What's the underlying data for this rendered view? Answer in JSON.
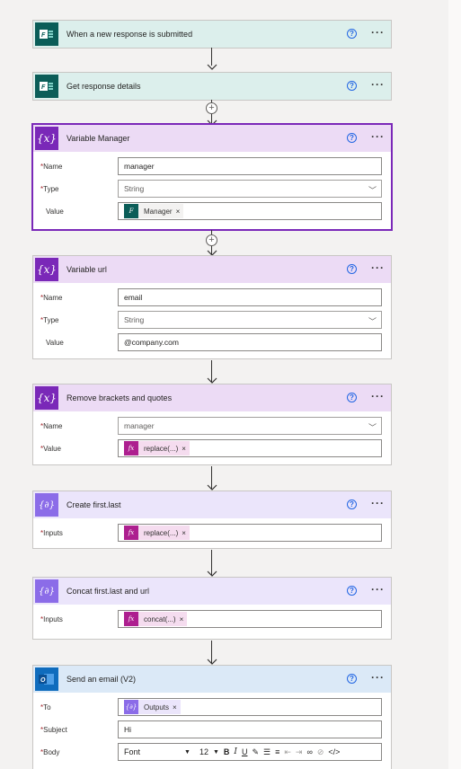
{
  "steps": [
    {
      "title": "When a new response is submitted",
      "icon": "forms-icon"
    },
    {
      "title": "Get response details",
      "icon": "forms-icon"
    },
    {
      "title": "Variable Manager",
      "icon": "variable-icon",
      "fields": {
        "name_label": "Name",
        "name_value": "manager",
        "type_label": "Type",
        "type_value": "String",
        "value_label": "Value",
        "value_token": "Manager"
      }
    },
    {
      "title": "Variable url",
      "icon": "variable-icon",
      "fields": {
        "name_label": "Name",
        "name_value": "email",
        "type_label": "Type",
        "type_value": "String",
        "value_label": "Value",
        "value_value": "@company.com"
      }
    },
    {
      "title": "Remove brackets and quotes",
      "icon": "variable-icon",
      "fields": {
        "name_label": "Name",
        "name_value": "manager",
        "value_label": "Value",
        "value_token": "replace(...)"
      }
    },
    {
      "title": "Create first.last",
      "icon": "data-operation-icon",
      "fields": {
        "inputs_label": "Inputs",
        "inputs_token": "replace(...)"
      }
    },
    {
      "title": "Concat first.last and url",
      "icon": "data-operation-icon",
      "fields": {
        "inputs_label": "Inputs",
        "inputs_token": "concat(...)"
      }
    },
    {
      "title": "Send an email (V2)",
      "icon": "outlook-icon",
      "fields": {
        "to_label": "To",
        "to_token": "Outputs",
        "subject_label": "Subject",
        "subject_value": "Hi",
        "body_label": "Body",
        "font_value": "Font",
        "size_value": "12"
      }
    }
  ],
  "common": {
    "help_glyph": "?",
    "more_glyph": "···",
    "required_mark": "*",
    "remove_glyph": "×",
    "fx_glyph": "fx",
    "var_glyph": "{x}",
    "data_glyph": "{∂}"
  },
  "colors": {
    "forms": "#0b5d58",
    "variable": "#7a28b8",
    "data_operation": "#8b6ce8",
    "outlook": "#0f6cbd",
    "expression_token": "#ad1f8f"
  }
}
